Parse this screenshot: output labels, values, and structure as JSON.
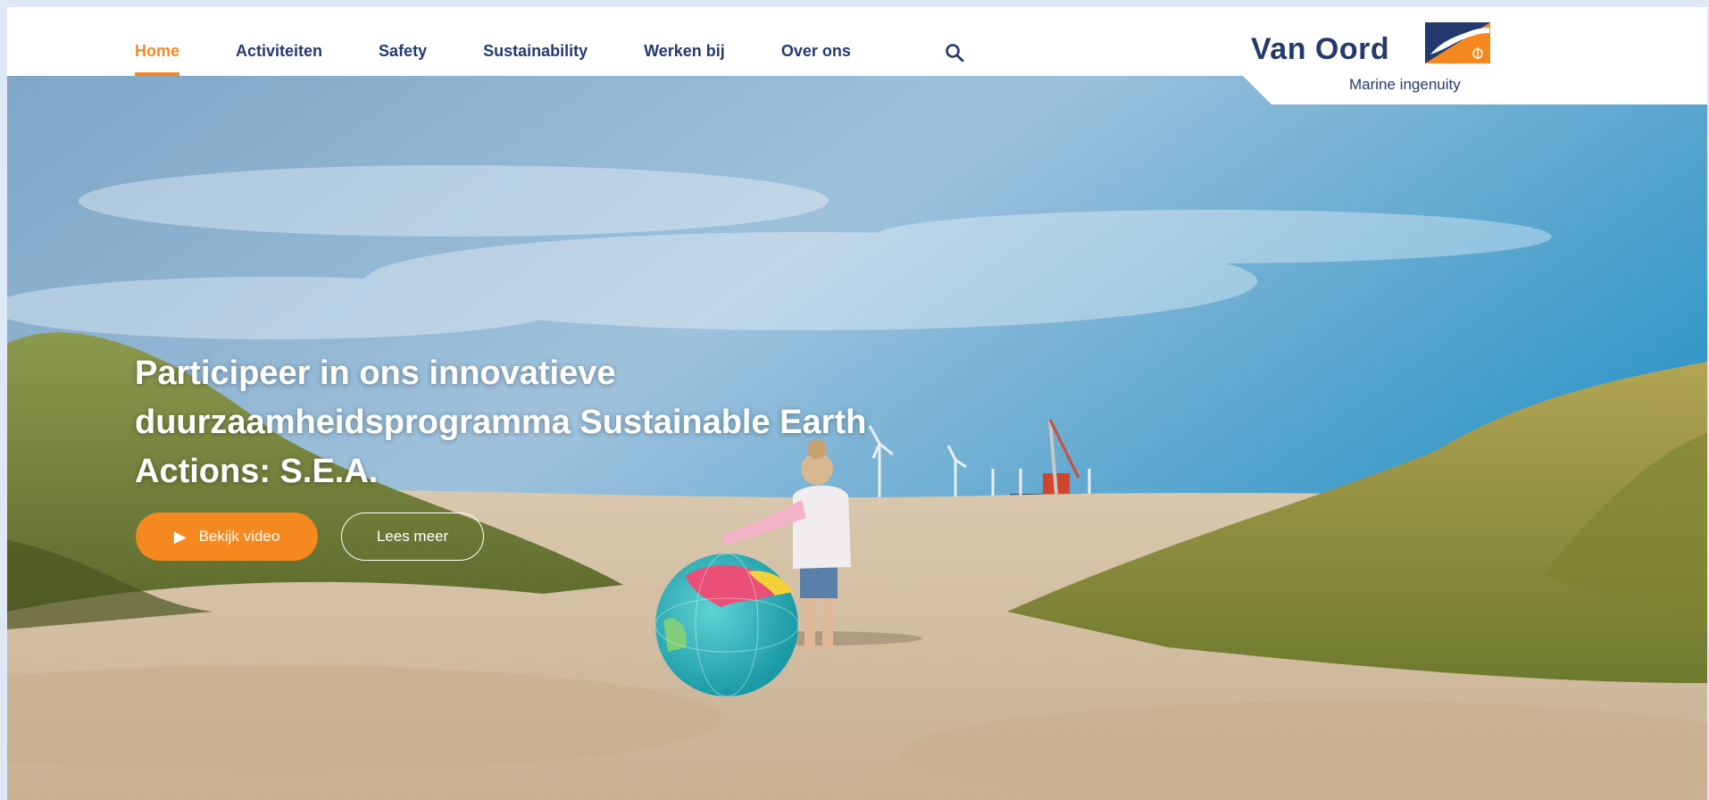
{
  "brand": {
    "name": "Van Oord",
    "tagline": "Marine ingenuity",
    "colors": {
      "navy": "#233a6e",
      "orange": "#f5891f",
      "blue": "#2a5ca8"
    }
  },
  "nav": {
    "items": [
      {
        "label": "Home",
        "active": true
      },
      {
        "label": "Activiteiten",
        "active": false
      },
      {
        "label": "Safety",
        "active": false
      },
      {
        "label": "Sustainability",
        "active": false
      },
      {
        "label": "Werken bij",
        "active": false
      },
      {
        "label": "Over ons",
        "active": false
      }
    ],
    "search_icon": "search-icon"
  },
  "hero": {
    "title": "Participeer in ons innovatieve duurzaamheidsprogramma Sustainable Earth Actions: S.E.A.",
    "video_button": {
      "icon": "play-icon",
      "label": "Bekijk video"
    },
    "more_button": {
      "label": "Lees meer"
    }
  }
}
